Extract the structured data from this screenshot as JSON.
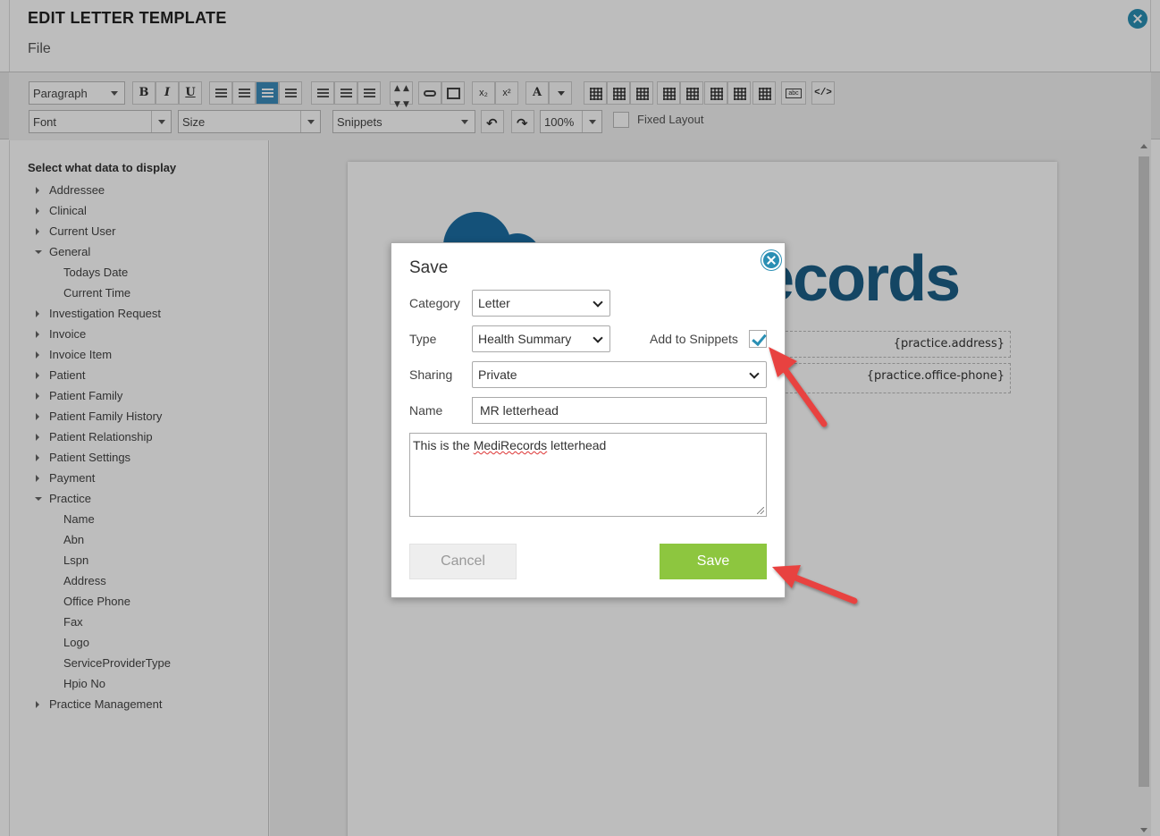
{
  "window": {
    "title": "EDIT LETTER TEMPLATE",
    "menu_file": "File"
  },
  "toolbar": {
    "format_select": "Paragraph",
    "bold": "B",
    "italic": "I",
    "underline": "U",
    "subscript": "x₂",
    "superscript": "x²",
    "font_color": "A",
    "font_select": "Font",
    "size_select": "Size",
    "snippets_select": "Snippets",
    "zoom_select": "100%",
    "source_code": "</>",
    "fixed_layout_label": "Fixed Layout"
  },
  "sidebar": {
    "heading": "Select what data to display",
    "items": [
      {
        "label": "Addressee",
        "level": 0,
        "expanded": false
      },
      {
        "label": "Clinical",
        "level": 0,
        "expanded": false
      },
      {
        "label": "Current User",
        "level": 0,
        "expanded": false
      },
      {
        "label": "General",
        "level": 0,
        "expanded": true
      },
      {
        "label": "Todays Date",
        "level": 1
      },
      {
        "label": "Current Time",
        "level": 1
      },
      {
        "label": "Investigation Request",
        "level": 0,
        "expanded": false
      },
      {
        "label": "Invoice",
        "level": 0,
        "expanded": false
      },
      {
        "label": "Invoice Item",
        "level": 0,
        "expanded": false
      },
      {
        "label": "Patient",
        "level": 0,
        "expanded": false
      },
      {
        "label": "Patient Family",
        "level": 0,
        "expanded": false
      },
      {
        "label": "Patient Family History",
        "level": 0,
        "expanded": false
      },
      {
        "label": "Patient Relationship",
        "level": 0,
        "expanded": false
      },
      {
        "label": "Patient Settings",
        "level": 0,
        "expanded": false
      },
      {
        "label": "Payment",
        "level": 0,
        "expanded": false
      },
      {
        "label": "Practice",
        "level": 0,
        "expanded": true
      },
      {
        "label": "Name",
        "level": 1
      },
      {
        "label": "Abn",
        "level": 1
      },
      {
        "label": "Lspn",
        "level": 1
      },
      {
        "label": "Address",
        "level": 1
      },
      {
        "label": "Office Phone",
        "level": 1
      },
      {
        "label": "Fax",
        "level": 1
      },
      {
        "label": "Logo",
        "level": 1
      },
      {
        "label": "ServiceProviderType",
        "level": 1
      },
      {
        "label": "Hpio No",
        "level": 1
      },
      {
        "label": "Practice Management",
        "level": 0,
        "expanded": false
      }
    ]
  },
  "document": {
    "logo_text": "ecords",
    "field_address": "{practice.address}",
    "field_phone": "{practice.office-phone}"
  },
  "dialog": {
    "title": "Save",
    "category_label": "Category",
    "category_value": "Letter",
    "type_label": "Type",
    "type_value": "Health Summary",
    "snippets_label": "Add to Snippets",
    "snippets_checked": true,
    "sharing_label": "Sharing",
    "sharing_value": "Private",
    "name_label": "Name",
    "name_value": "MR letterhead",
    "description_before": "This is the ",
    "description_misspelled": "MediRecords",
    "description_after": " letterhead",
    "cancel_label": "Cancel",
    "save_label": "Save"
  },
  "colors": {
    "accent": "#2a8fb4",
    "save_button": "#8dc63f",
    "annotation_arrow": "#e8423f",
    "logo_blue": "#1b5f88"
  }
}
